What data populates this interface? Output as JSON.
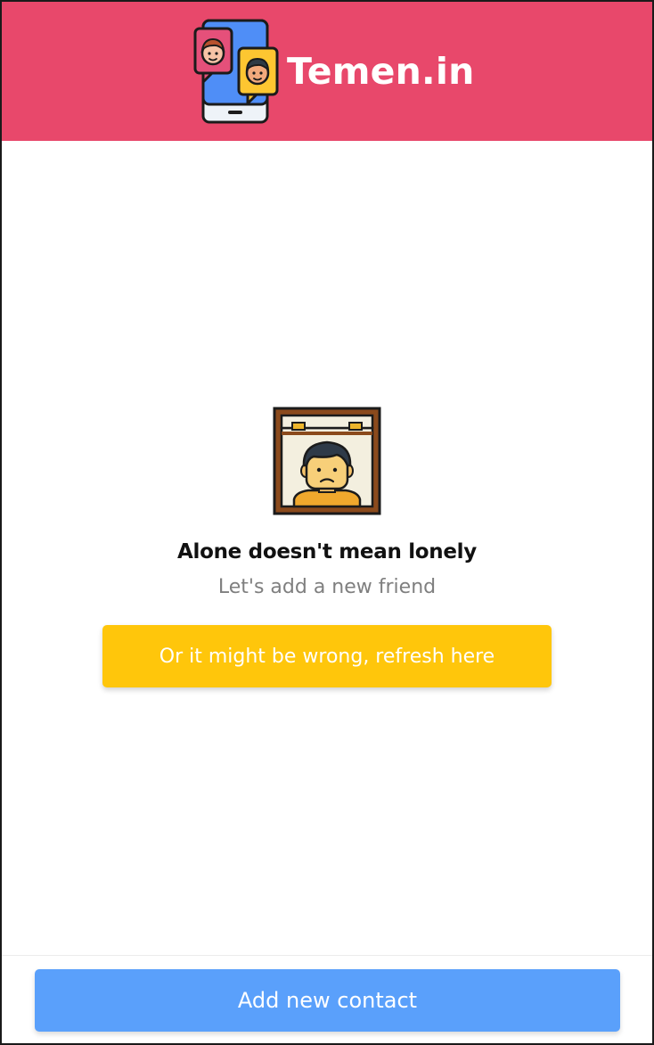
{
  "app": {
    "title": "Temen.in",
    "logo_icon": "chat-phone-icon",
    "header_color": "#e8486b"
  },
  "empty_state": {
    "illustration_icon": "lonely-person-window-icon",
    "heading": "Alone doesn't mean lonely",
    "subheading": "Let's add a new friend",
    "refresh_label": "Or it might be wrong, refresh here",
    "refresh_color": "#ffc60b"
  },
  "footer": {
    "add_contact_label": "Add new contact",
    "button_color": "#5aa0fb"
  }
}
